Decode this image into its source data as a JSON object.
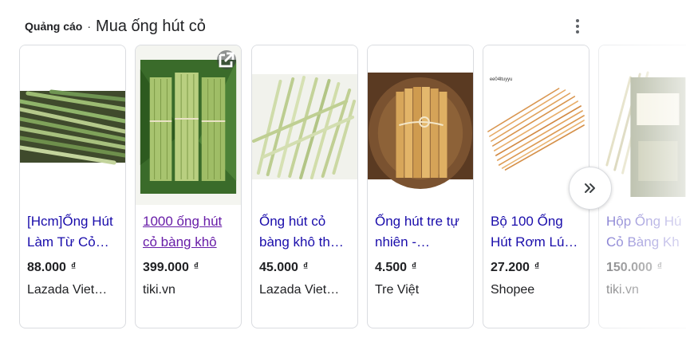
{
  "header": {
    "ad_label": "Quảng cáo",
    "separator": "·",
    "title": "Mua ống hút cỏ"
  },
  "products": [
    {
      "name_line1": "[Hcm]Ống Hút",
      "name_line2": "Làm Từ Cỏ…",
      "price": "88.000",
      "currency": "₫",
      "store": "Lazada Viet…"
    },
    {
      "name_line1": "1000 ống hút",
      "name_line2": "cỏ bàng khô",
      "price": "399.000",
      "currency": "₫",
      "store": "tiki.vn"
    },
    {
      "name_line1": "Ống hút cỏ",
      "name_line2": "bàng khô th…",
      "price": "45.000",
      "currency": "₫",
      "store": "Lazada Viet…"
    },
    {
      "name_line1": "Ống hút tre tự",
      "name_line2": "nhiên -…",
      "price": "4.500",
      "currency": "₫",
      "store": "Tre Việt"
    },
    {
      "name_line1": "Bộ 100 Ống",
      "name_line2": "Hút Rơm Lú…",
      "price": "27.200",
      "currency": "₫",
      "store": "Shopee",
      "image_caption": "ee04ltuyyu"
    },
    {
      "name_line1": "Hộp Ống Hú",
      "name_line2": "Cỏ Bàng Kh",
      "price": "150.000",
      "currency": "₫",
      "store": "tiki.vn"
    }
  ],
  "icons": {
    "more": "more-vert-icon",
    "next": "double-chevron-right-icon",
    "external": "open-in-new-icon"
  },
  "colors": {
    "link": "#1a0dab",
    "visited_link": "#681da8",
    "text": "#202124",
    "border": "#dadce0"
  }
}
